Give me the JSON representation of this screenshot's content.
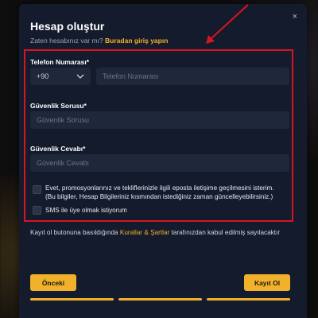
{
  "modal": {
    "title": "Hesap oluştur",
    "close_glyph": "×",
    "login_prompt": "Zaten hesabınız var mı?",
    "login_link": "Buradan giriş yapın"
  },
  "form": {
    "phone_label": "Telefon Numarası*",
    "country_code": "+90",
    "phone_placeholder": "Telefon Numarası",
    "question_label": "Güvenlik Sorusu*",
    "question_placeholder": "Güvenlik Sorusu",
    "answer_label": "Güvenlik Cevabı*",
    "answer_placeholder": "Güvenlik Cevabı",
    "email_consent_line1": "Evet, promosyonlarınız ve tekliflerinizle ilgili eposta iletişime geçilmesini isterim.",
    "email_consent_line2": "(Bu bilgiler, Hesap Bilgileriniz kısmından istediğiniz zaman güncelleyebilirsiniz.)",
    "sms_consent": "SMS ile üye olmak istiyorum"
  },
  "terms": {
    "prefix": "Kayıt ol butonuna basıldığında",
    "link": "Kurallar & Şartlar",
    "suffix": "tarafınızdan kabul edilmiş sayılacaktır"
  },
  "buttons": {
    "back": "Önceki",
    "register": "Kayıt Ol"
  },
  "colors": {
    "accent": "#f2b12a",
    "highlight": "#d8141e",
    "panel": "#141b2d",
    "field": "#1f273b"
  },
  "icons": {
    "close": "close-icon",
    "dropdown": "chevron-down-icon",
    "annotation": "red-arrow-icon"
  }
}
